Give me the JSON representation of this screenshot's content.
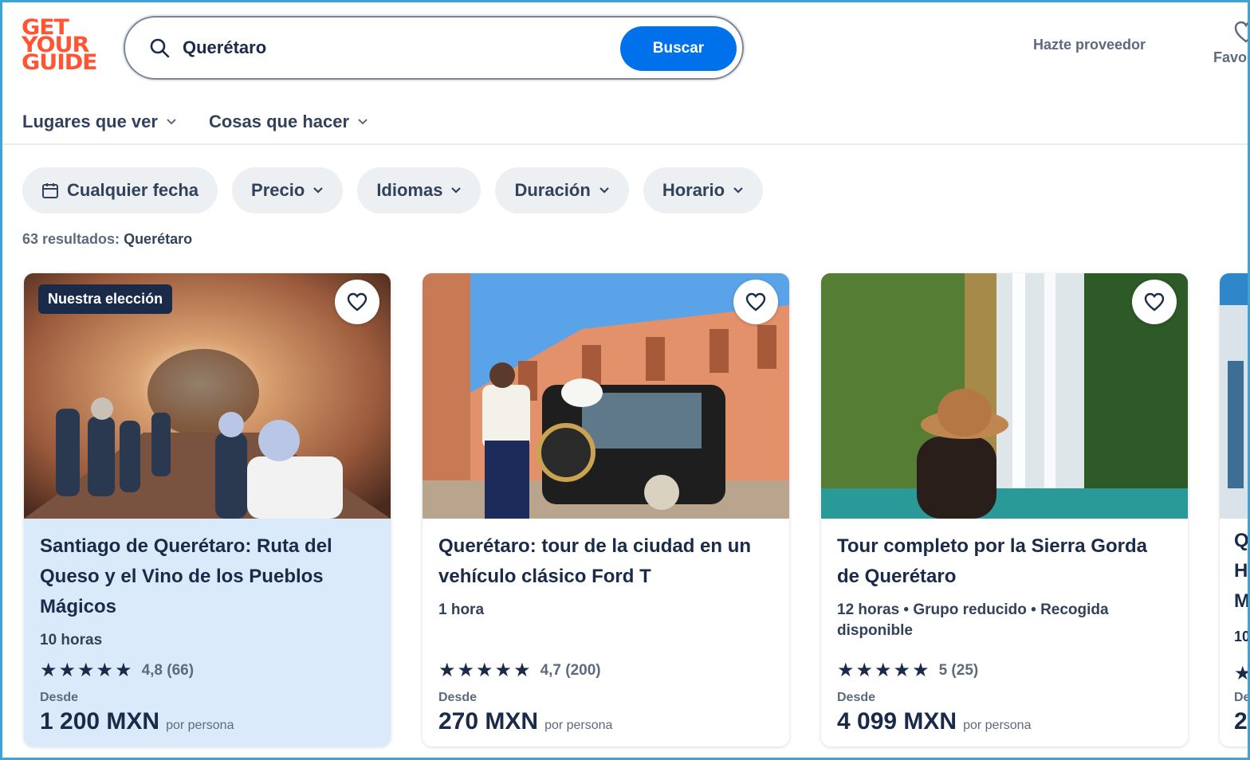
{
  "header": {
    "logo_lines": [
      "GET",
      "YOUR",
      "GUIDE"
    ],
    "search_value": "Querétaro",
    "search_button": "Buscar",
    "provider_link": "Hazte proveedor",
    "favorites_label": "Favo"
  },
  "nav": {
    "items": [
      {
        "label": "Lugares que ver"
      },
      {
        "label": "Cosas que hacer"
      }
    ]
  },
  "filters": {
    "chips": [
      {
        "label": "Cualquier fecha"
      },
      {
        "label": "Precio"
      },
      {
        "label": "Idiomas"
      },
      {
        "label": "Duración"
      },
      {
        "label": "Horario"
      }
    ]
  },
  "results": {
    "count_text": "63 resultados:",
    "query": "Querétaro"
  },
  "cards": [
    {
      "badge": "Nuestra elección",
      "title": "Santiago de Querétaro: Ruta del Queso y el Vino de los Pueblos Mágicos",
      "meta": "10 horas",
      "stars": "★★★★★",
      "rating": "4,8 (66)",
      "from": "Desde",
      "price": "1 200 MXN",
      "per": "por persona"
    },
    {
      "title": "Querétaro: tour de la ciudad en un vehículo clásico Ford T",
      "meta": "1 hora",
      "stars": "★★★★★",
      "rating": "4,7 (200)",
      "from": "Desde",
      "price": "270 MXN",
      "per": "por persona"
    },
    {
      "title": "Tour completo por la Sierra Gorda de Querétaro",
      "meta": "12 horas • Grupo reducido • Recogida disponible",
      "stars": "★★★★★",
      "rating": "5 (25)",
      "from": "Desde",
      "price": "4 099 MXN",
      "per": "por persona"
    }
  ],
  "card4_fragments": [
    "Q",
    "H",
    "M",
    "10",
    "★",
    "De",
    "2"
  ],
  "colors": {
    "brand": "#ff5533",
    "accent": "#0071eb",
    "text": "#1a2b49",
    "selected_card": "#dbeafb"
  }
}
